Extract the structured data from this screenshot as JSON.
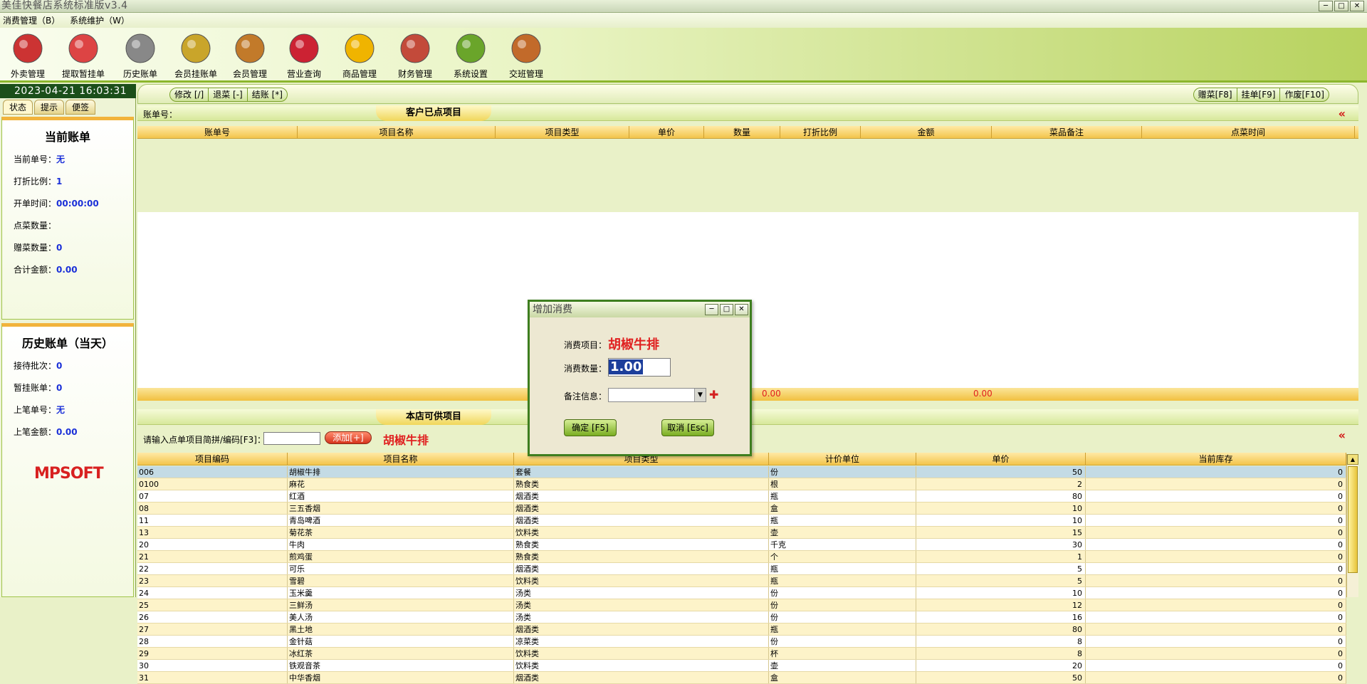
{
  "window": {
    "title": "美佳快餐店系统标准版v3.4",
    "min": "─",
    "max": "□",
    "close": "✕"
  },
  "menu": [
    "消费管理（B）",
    "系统维护（W）"
  ],
  "toolbar": [
    {
      "label": "外卖管理",
      "icon": "takeout-icon"
    },
    {
      "label": "提取暂挂单",
      "icon": "retrieve-icon"
    },
    {
      "label": "历史账单",
      "icon": "history-icon"
    },
    {
      "label": "会员挂账单",
      "icon": "member-bill-icon"
    },
    {
      "label": "会员管理",
      "icon": "member-icon"
    },
    {
      "label": "营业查询",
      "icon": "query-icon"
    },
    {
      "label": "商品管理",
      "icon": "goods-icon"
    },
    {
      "label": "财务管理",
      "icon": "finance-icon"
    },
    {
      "label": "系统设置",
      "icon": "settings-icon"
    },
    {
      "label": "交班管理",
      "icon": "shift-icon"
    }
  ],
  "left": {
    "clock": "2023-04-21 16:03:31",
    "tabs": [
      "状态",
      "提示",
      "便签"
    ],
    "current": {
      "title": "当前账单",
      "rows": [
        {
          "k": "当前单号：",
          "v": "无"
        },
        {
          "k": "打折比例：",
          "v": "1"
        },
        {
          "k": "开单时间：",
          "v": "00:00:00"
        },
        {
          "k": "点菜数量：",
          "v": ""
        },
        {
          "k": "赠菜数量：",
          "v": "0"
        },
        {
          "k": "合计金额：",
          "v": "0.00"
        }
      ]
    },
    "history": {
      "title": "历史账单（当天）",
      "rows": [
        {
          "k": "接待批次：",
          "v": "0"
        },
        {
          "k": "暂挂账单：",
          "v": "0"
        },
        {
          "k": "上笔单号：",
          "v": "无"
        },
        {
          "k": "上笔金额：",
          "v": "0.00"
        }
      ]
    },
    "logo": "MPSOFT"
  },
  "topbar": {
    "left": [
      "修改 [/]",
      "退菜 [-]",
      "结账 [*]"
    ],
    "right": [
      "赠菜[F8]",
      "挂单[F9]",
      "作废[F10]"
    ]
  },
  "ordered": {
    "title": "客户已点项目",
    "billno_label": "账单号：",
    "columns": [
      "账单号",
      "项目名称",
      "项目类型",
      "单价",
      "数量",
      "打折比例",
      "金额",
      "菜品备注",
      "点菜时间"
    ],
    "sum_qty": "0.00",
    "sum_amount": "0.00"
  },
  "available": {
    "title": "本店可供项目",
    "input_label": "请输入点单项目简拼/编码[F3]：",
    "add_btn": "添加[+]",
    "selected": "胡椒牛排",
    "columns": [
      "项目编码",
      "项目名称",
      "项目类型",
      "计价单位",
      "单价",
      "当前库存"
    ],
    "rows": [
      [
        "006",
        "胡椒牛排",
        "套餐",
        "份",
        "50",
        "0"
      ],
      [
        "0100",
        "麻花",
        "熟食类",
        "根",
        "2",
        "0"
      ],
      [
        "07",
        "红酒",
        "烟酒类",
        "瓶",
        "80",
        "0"
      ],
      [
        "08",
        "三五香烟",
        "烟酒类",
        "盒",
        "10",
        "0"
      ],
      [
        "11",
        "青岛啤酒",
        "烟酒类",
        "瓶",
        "10",
        "0"
      ],
      [
        "13",
        "菊花茶",
        "饮料类",
        "壶",
        "15",
        "0"
      ],
      [
        "20",
        "牛肉",
        "熟食类",
        "千克",
        "30",
        "0"
      ],
      [
        "21",
        "煎鸡蛋",
        "熟食类",
        "个",
        "1",
        "0"
      ],
      [
        "22",
        "可乐",
        "烟酒类",
        "瓶",
        "5",
        "0"
      ],
      [
        "23",
        "雪碧",
        "饮料类",
        "瓶",
        "5",
        "0"
      ],
      [
        "24",
        "玉米羹",
        "汤类",
        "份",
        "10",
        "0"
      ],
      [
        "25",
        "三鲜汤",
        "汤类",
        "份",
        "12",
        "0"
      ],
      [
        "26",
        "美人汤",
        "汤类",
        "份",
        "16",
        "0"
      ],
      [
        "27",
        "黑土地",
        "烟酒类",
        "瓶",
        "80",
        "0"
      ],
      [
        "28",
        "金针菇",
        "凉菜类",
        "份",
        "8",
        "0"
      ],
      [
        "29",
        "冰红茶",
        "饮料类",
        "杯",
        "8",
        "0"
      ],
      [
        "30",
        "铁观音茶",
        "饮料类",
        "壶",
        "20",
        "0"
      ],
      [
        "31",
        "中华香烟",
        "烟酒类",
        "盒",
        "50",
        "0"
      ]
    ]
  },
  "dialog": {
    "title": "增加消费",
    "item_label": "消费项目：",
    "item_value": "胡椒牛排",
    "qty_label": "消费数量：",
    "qty_value": "1.00",
    "note_label": "备注信息：",
    "ok": "确定 [F5]",
    "cancel": "取消 [Esc]"
  }
}
